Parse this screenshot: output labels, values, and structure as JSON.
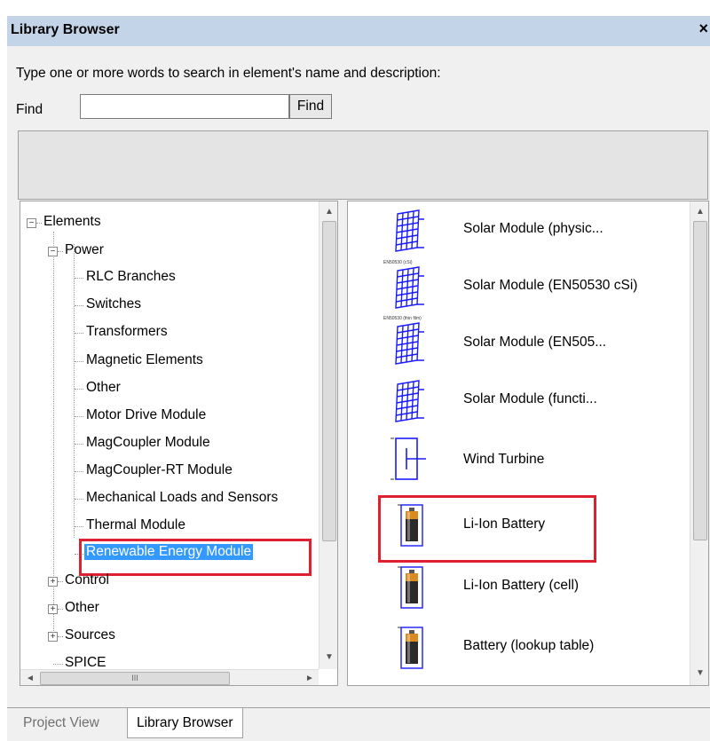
{
  "window": {
    "title": "Library Browser",
    "close_glyph": "×"
  },
  "search": {
    "prompt": "Type one or more words to search in element's name and  description:",
    "find_label": "Find",
    "find_value": "",
    "find_button": "Find"
  },
  "tree": {
    "root": "Elements",
    "power": "Power",
    "power_children": [
      "RLC Branches",
      "Switches",
      "Transformers",
      "Magnetic Elements",
      "Other",
      "Motor Drive Module",
      "MagCoupler Module",
      "MagCoupler-RT Module",
      "Mechanical Loads and Sensors",
      "Thermal Module",
      "Renewable Energy Module"
    ],
    "selected": "Renewable Energy Module",
    "siblings": [
      "Control",
      "Other",
      "Sources",
      "SPICE"
    ],
    "hscroll_grip": "III"
  },
  "elements": {
    "items": [
      {
        "label": "Solar Module (physic...",
        "icon": "solar-panel-icon",
        "tag": ""
      },
      {
        "label": "Solar Module (EN50530 cSi)",
        "icon": "solar-panel-icon",
        "tag": "EN50530 (cSi)"
      },
      {
        "label": "Solar Module (EN505...",
        "icon": "solar-panel-icon",
        "tag": "EN50530 (thin film)"
      },
      {
        "label": "Solar Module (functi...",
        "icon": "solar-panel-icon",
        "tag": ""
      },
      {
        "label": "Wind Turbine",
        "icon": "wind-turbine-icon",
        "tag": ""
      },
      {
        "label": "Li-Ion Battery",
        "icon": "battery-icon",
        "tag": ""
      },
      {
        "label": "Li-Ion Battery (cell)",
        "icon": "battery-icon",
        "tag": ""
      },
      {
        "label": "Battery (lookup table)",
        "icon": "battery-icon",
        "tag": ""
      }
    ]
  },
  "tabs": [
    "Project View",
    "Library Browser"
  ],
  "colors": {
    "titlebar": "#c4d4e8",
    "selection": "#3399ff",
    "highlight": "#e02030",
    "symbol": "#1a1aff"
  }
}
